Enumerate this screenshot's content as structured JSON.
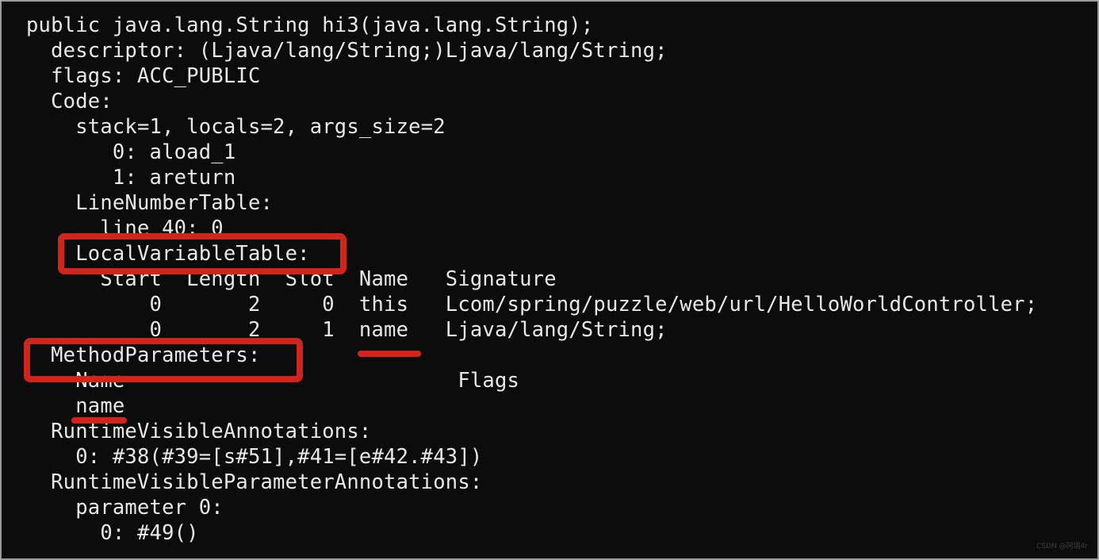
{
  "terminal": {
    "lines": [
      "public java.lang.String hi3(java.lang.String);",
      "  descriptor: (Ljava/lang/String;)Ljava/lang/String;",
      "  flags: ACC_PUBLIC",
      "  Code:",
      "    stack=1, locals=2, args_size=2",
      "       0: aload_1",
      "       1: areturn",
      "    LineNumberTable:",
      "      line 40: 0",
      "    LocalVariableTable:",
      "      Start  Length  Slot  Name   Signature",
      "          0       2     0  this   Lcom/spring/puzzle/web/url/HelloWorldController;",
      "          0       2     1  name   Ljava/lang/String;",
      "  MethodParameters:",
      "    Name                           Flags",
      "    name",
      "  RuntimeVisibleAnnotations:",
      "    0: #38(#39=[s#51],#41=[e#42.#43])",
      "  RuntimeVisibleParameterAnnotations:",
      "    parameter 0:",
      "      0: #49()"
    ],
    "highlight_color": "#d0251c",
    "background_color": "#0c0c0c",
    "text_color": "#e8e8e8"
  },
  "watermark": "CSDN @阿瑞4r"
}
